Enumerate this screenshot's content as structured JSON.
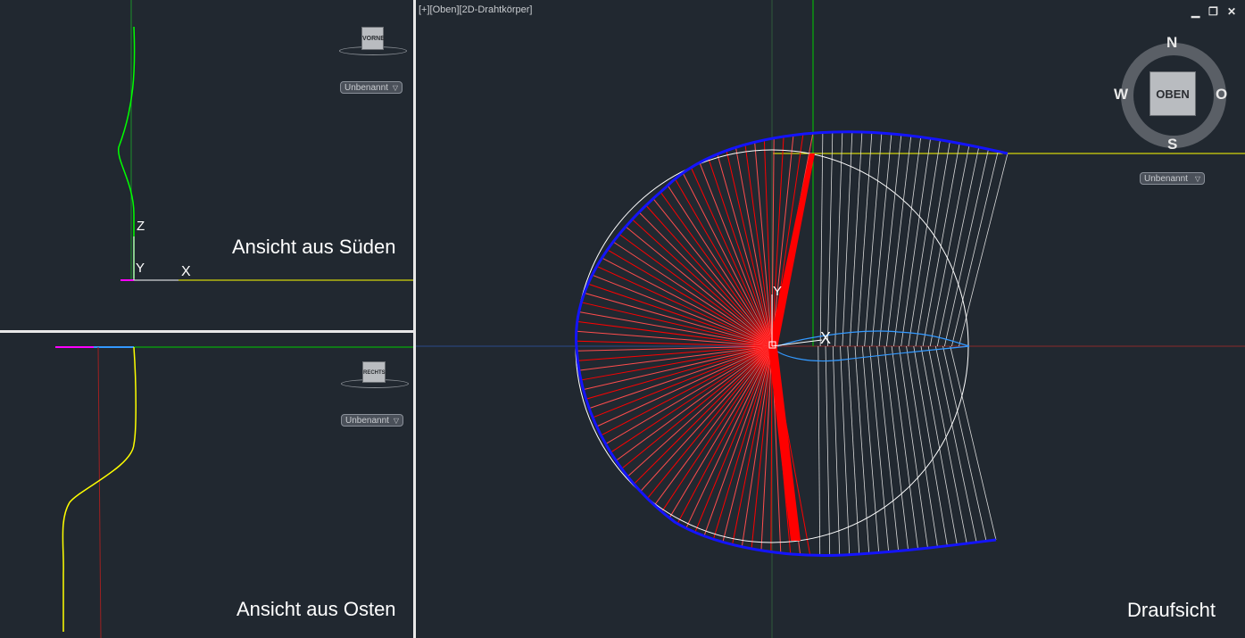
{
  "viewport_title": "[+][Oben][2D-Drahtkörper]",
  "window_controls": {
    "minimize": "▁",
    "restore": "❐",
    "close": "✕"
  },
  "views": {
    "south": {
      "label": "Ansicht aus Süden",
      "cube_face": "VORNE",
      "named_view": "Unbenannt"
    },
    "east": {
      "label": "Ansicht aus Osten",
      "cube_face": "RECHTS",
      "named_view": "Unbenannt"
    },
    "top": {
      "label": "Draufsicht",
      "cube_face": "OBEN",
      "named_view": "Unbenannt",
      "compass": {
        "n": "N",
        "s": "S",
        "w": "W",
        "e": "O"
      }
    }
  },
  "ucs": {
    "x": "X",
    "y": "Y",
    "z": "Z"
  },
  "colors": {
    "background": "#212830",
    "blue": "#1414ff",
    "red": "#ff0000",
    "white": "#ffffff",
    "yellow": "#ffff00",
    "green": "#00ff00",
    "cyan": "#3399ff"
  }
}
